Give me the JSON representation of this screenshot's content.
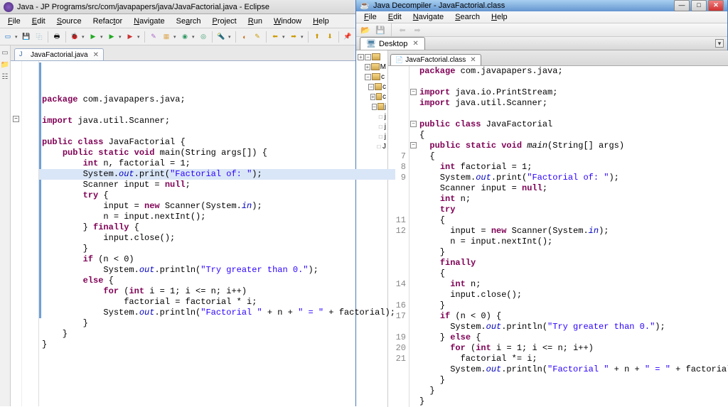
{
  "eclipse": {
    "title": "Java - JP Programs/src/com/javapapers/java/JavaFactorial.java - Eclipse",
    "menu": [
      "File",
      "Edit",
      "Source",
      "Refactor",
      "Navigate",
      "Search",
      "Project",
      "Run",
      "Window",
      "Help"
    ],
    "tab_name": "JavaFactorial.java",
    "code_html": "<span class='kw'>package</span> com.javapapers.java;\n\n<span class='kw'>import</span> java.util.Scanner;\n\n<span class='kw'>public</span> <span class='kw'>class</span> JavaFactorial {\n    <span class='kw'>public</span> <span class='kw'>static</span> <span class='kw'>void</span> main(String args[]) {\n        <span class='kw'>int</span> n, factorial = 1;\n<span class='hl'>        System.<span class='fld'>out</span>.print(<span class='str'>\"Factorial of: \"</span>);</span>        Scanner input = <span class='kw'>null</span>;\n        <span class='kw'>try</span> {\n            input = <span class='kw'>new</span> Scanner(System.<span class='fld'>in</span>);\n            n = input.nextInt();\n        } <span class='kw'>finally</span> {\n            input.close();\n        }\n        <span class='kw'>if</span> (n < 0)\n            System.<span class='fld'>out</span>.println(<span class='str'>\"Try greater than 0.\"</span>);\n        <span class='kw'>else</span> {\n            <span class='kw'>for</span> (<span class='kw'>int</span> i = 1; i <= n; i++)\n                factorial = factorial * i;\n            System.<span class='fld'>out</span>.println(<span class='str'>\"Factorial \"</span> + n + <span class='str'>\" = \"</span> + factorial);\n        }\n    }\n}"
  },
  "jd": {
    "title": "Java Decompiler - JavaFactorial.class",
    "menu": [
      "File",
      "Edit",
      "Navigate",
      "Search",
      "Help"
    ],
    "desktop_tab": "Desktop",
    "tab_name": "JavaFactorial.class",
    "tree_letters": [
      "M",
      "c",
      "c",
      "c",
      "j",
      "j",
      "j",
      "j",
      "J"
    ],
    "line_numbers": [
      "",
      "",
      "",
      "",
      "",
      "",
      "",
      "",
      "7",
      "8",
      "9",
      "",
      "",
      "",
      "11",
      "12",
      "",
      "",
      "",
      "",
      "14",
      "",
      "16",
      "17",
      "",
      "19",
      "20",
      "21",
      "",
      "",
      ""
    ],
    "code_html": "<span class='kw'>package</span> com.javapapers.java;\n\n<span class='kw'>import</span> java.io.PrintStream;\n<span class='kw'>import</span> java.util.Scanner;\n\n<span class='kw'>public class</span> JavaFactorial\n{\n  <span class='kw'>public static void</span> <span style='font-style:italic'>main</span>(String[] args)\n  {\n    <span class='kw'>int</span> factorial = 1;\n    System.<span class='fld'>out</span>.print(<span class='str'>\"Factorial of: \"</span>);\n    Scanner input = <span class='kw'>null</span>;\n    <span class='kw'>int</span> n;\n    <span class='kw'>try</span>\n    {\n      input = <span class='kw'>new</span> Scanner(System.<span class='fld'>in</span>);\n      n = input.nextInt();\n    }\n    <span class='kw'>finally</span>\n    {\n      <span class='kw'>int</span> n;\n      input.close();\n    }\n    <span class='kw'>if</span> (n < 0) {\n      System.<span class='fld'>out</span>.println(<span class='str'>\"Try greater than 0.\"</span>);\n    } <span class='kw'>else</span> {\n      <span class='kw'>for</span> (<span class='kw'>int</span> i = 1; i <= n; i++)\n        factorial *= i;\n      System.<span class='fld'>out</span>.println(<span class='str'>\"Factorial \"</span> + n + <span class='str'>\" = \"</span> + factorial);\n    }\n  }\n}"
  }
}
